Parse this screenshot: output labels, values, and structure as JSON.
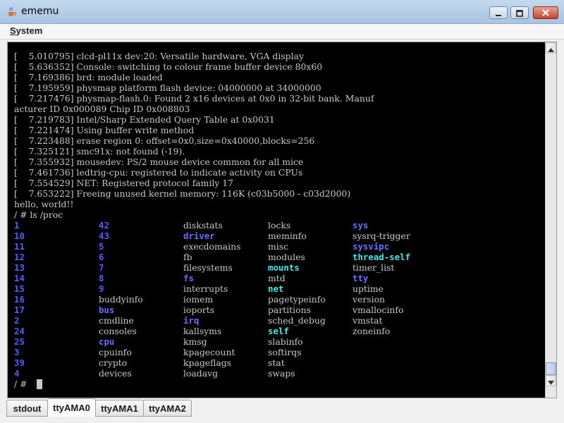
{
  "window": {
    "title": "ememu",
    "icon": "java-cup-icon",
    "controls": [
      "minimize-icon",
      "maximize-icon",
      "close-icon"
    ]
  },
  "menu": {
    "items": [
      {
        "label": "System",
        "mnemonic": "S"
      }
    ]
  },
  "terminal": {
    "log_lines": [
      "[    5.010795] clcd-pl11x dev:20: Versatile hardware, VGA display",
      "[    5.636352] Console: switching to colour frame buffer device 80x60",
      "[    7.169386] brd: module loaded",
      "[    7.195959] physmap platform flash device: 04000000 at 34000000",
      "[    7.217476] physmap-flash.0: Found 2 x16 devices at 0x0 in 32-bit bank. Manuf",
      "acturer ID 0x000089 Chip ID 0x008803",
      "[    7.219783] Intel/Sharp Extended Query Table at 0x0031",
      "[    7.221474] Using buffer write method",
      "[    7.223488] erase region 0: offset=0x0,size=0x40000,blocks=256",
      "[    7.325121] smc91x: not found (-19).",
      "[    7.355932] mousedev: PS/2 mouse device common for all mice",
      "[    7.461736] ledtrig-cpu: registered to indicate activity on CPUs",
      "[    7.554529] NET: Registered protocol family 17",
      "[    7.653222] Freeing unused kernel memory: 116K (c03b5000 - c03d2000)",
      "hello, world!!",
      "/ # ls /proc"
    ],
    "listing_columns": [
      [
        {
          "t": "1",
          "k": "num"
        },
        {
          "t": "10",
          "k": "num"
        },
        {
          "t": "11",
          "k": "num"
        },
        {
          "t": "12",
          "k": "num"
        },
        {
          "t": "13",
          "k": "num"
        },
        {
          "t": "14",
          "k": "num"
        },
        {
          "t": "15",
          "k": "num"
        },
        {
          "t": "16",
          "k": "num"
        },
        {
          "t": "17",
          "k": "num"
        },
        {
          "t": "2",
          "k": "num"
        },
        {
          "t": "24",
          "k": "num"
        },
        {
          "t": "25",
          "k": "num"
        },
        {
          "t": "3",
          "k": "num"
        },
        {
          "t": "39",
          "k": "num"
        },
        {
          "t": "4",
          "k": "num"
        }
      ],
      [
        {
          "t": "42",
          "k": "num"
        },
        {
          "t": "43",
          "k": "num"
        },
        {
          "t": "5",
          "k": "num"
        },
        {
          "t": "6",
          "k": "num"
        },
        {
          "t": "7",
          "k": "num"
        },
        {
          "t": "8",
          "k": "num"
        },
        {
          "t": "9",
          "k": "num"
        },
        {
          "t": "buddyinfo",
          "k": "file"
        },
        {
          "t": "bus",
          "k": "dir"
        },
        {
          "t": "cmdline",
          "k": "file"
        },
        {
          "t": "consoles",
          "k": "file"
        },
        {
          "t": "cpu",
          "k": "dir"
        },
        {
          "t": "cpuinfo",
          "k": "file"
        },
        {
          "t": "crypto",
          "k": "file"
        },
        {
          "t": "devices",
          "k": "file"
        }
      ],
      [
        {
          "t": "diskstats",
          "k": "file"
        },
        {
          "t": "driver",
          "k": "dir"
        },
        {
          "t": "execdomains",
          "k": "file"
        },
        {
          "t": "fb",
          "k": "file"
        },
        {
          "t": "filesystems",
          "k": "file"
        },
        {
          "t": "fs",
          "k": "dir"
        },
        {
          "t": "interrupts",
          "k": "file"
        },
        {
          "t": "iomem",
          "k": "file"
        },
        {
          "t": "ioports",
          "k": "file"
        },
        {
          "t": "irq",
          "k": "dir"
        },
        {
          "t": "kallsyms",
          "k": "file"
        },
        {
          "t": "kmsg",
          "k": "file"
        },
        {
          "t": "kpagecount",
          "k": "file"
        },
        {
          "t": "kpageflags",
          "k": "file"
        },
        {
          "t": "loadavg",
          "k": "file"
        }
      ],
      [
        {
          "t": "locks",
          "k": "file"
        },
        {
          "t": "meminfo",
          "k": "file"
        },
        {
          "t": "misc",
          "k": "file"
        },
        {
          "t": "modules",
          "k": "file"
        },
        {
          "t": "mounts",
          "k": "link"
        },
        {
          "t": "mtd",
          "k": "file"
        },
        {
          "t": "net",
          "k": "link"
        },
        {
          "t": "pagetypeinfo",
          "k": "file"
        },
        {
          "t": "partitions",
          "k": "file"
        },
        {
          "t": "sched_debug",
          "k": "file"
        },
        {
          "t": "self",
          "k": "link"
        },
        {
          "t": "slabinfo",
          "k": "file"
        },
        {
          "t": "softirqs",
          "k": "file"
        },
        {
          "t": "stat",
          "k": "file"
        },
        {
          "t": "swaps",
          "k": "file"
        }
      ],
      [
        {
          "t": "sys",
          "k": "dir"
        },
        {
          "t": "sysrq-trigger",
          "k": "file"
        },
        {
          "t": "sysvipc",
          "k": "dir"
        },
        {
          "t": "thread-self",
          "k": "link"
        },
        {
          "t": "timer_list",
          "k": "file"
        },
        {
          "t": "tty",
          "k": "dir"
        },
        {
          "t": "uptime",
          "k": "file"
        },
        {
          "t": "version",
          "k": "file"
        },
        {
          "t": "vmallocinfo",
          "k": "file"
        },
        {
          "t": "vmstat",
          "k": "file"
        },
        {
          "t": "zoneinfo",
          "k": "file"
        }
      ]
    ],
    "prompt": "/ # "
  },
  "tabs": [
    {
      "label": "stdout",
      "active": false
    },
    {
      "label": "ttyAMA0",
      "active": true
    },
    {
      "label": "ttyAMA1",
      "active": false
    },
    {
      "label": "ttyAMA2",
      "active": false
    }
  ],
  "colors": {
    "terminal_bg": "#000000",
    "text": "#c8c8c8",
    "number_entry": "#5a5aff",
    "directory": "#6b6bff",
    "symlink": "#3fe8e8"
  }
}
